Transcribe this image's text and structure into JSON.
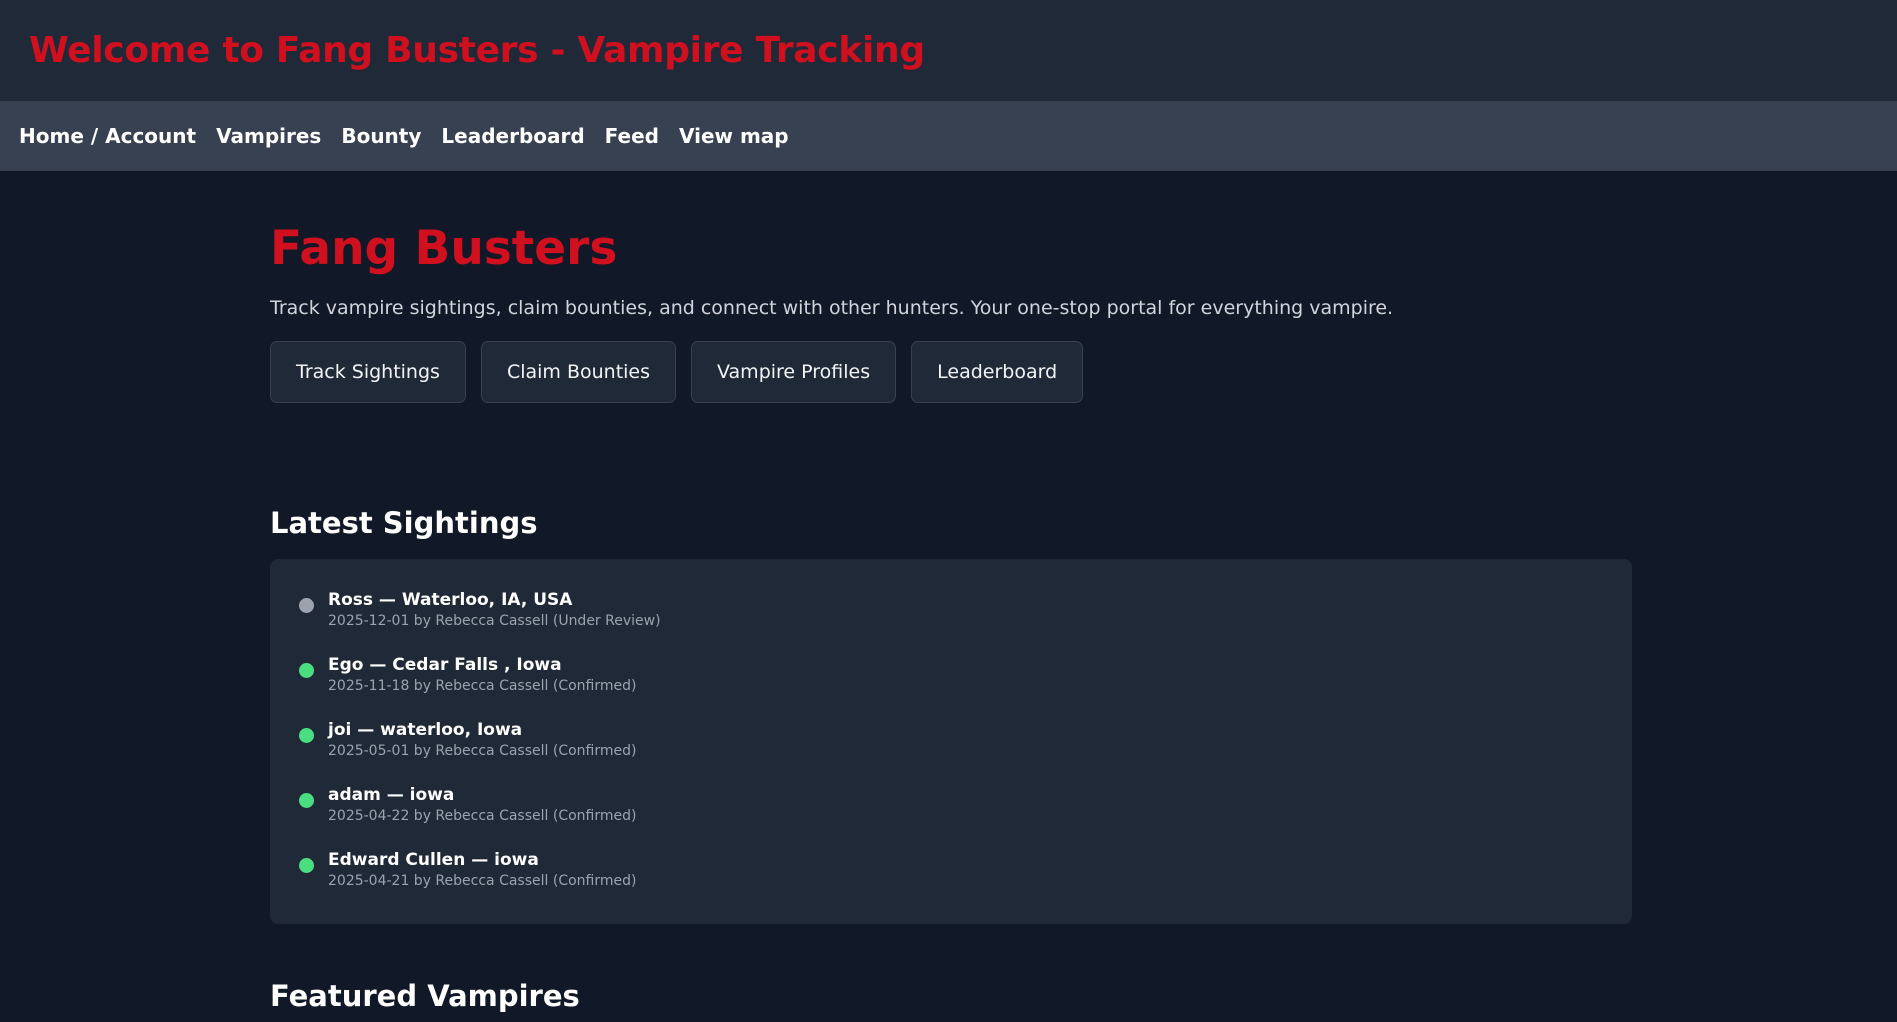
{
  "header": {
    "title": "Welcome to Fang Busters - Vampire Tracking"
  },
  "nav": {
    "items": [
      "Home / Account",
      "Vampires",
      "Bounty",
      "Leaderboard",
      "Feed",
      "View map"
    ]
  },
  "hero": {
    "title": "Fang Busters",
    "description": "Track vampire sightings, claim bounties, and connect with other hunters. Your one-stop portal for everything vampire.",
    "buttons": [
      "Track Sightings",
      "Claim Bounties",
      "Vampire Profiles",
      "Leaderboard"
    ]
  },
  "sightings": {
    "title": "Latest Sightings",
    "items": [
      {
        "title": "Ross — Waterloo, IA, USA",
        "meta": "2025-12-01 by Rebecca Cassell (Under Review)",
        "status_color": "#9ca3af"
      },
      {
        "title": "Ego — Cedar Falls , Iowa",
        "meta": "2025-11-18 by Rebecca Cassell (Confirmed)",
        "status_color": "#4ade80"
      },
      {
        "title": "joi — waterloo, Iowa",
        "meta": "2025-05-01 by Rebecca Cassell (Confirmed)",
        "status_color": "#4ade80"
      },
      {
        "title": "adam — iowa",
        "meta": "2025-04-22 by Rebecca Cassell (Confirmed)",
        "status_color": "#4ade80"
      },
      {
        "title": "Edward Cullen — iowa",
        "meta": "2025-04-21 by Rebecca Cassell (Confirmed)",
        "status_color": "#4ade80"
      }
    ]
  },
  "featured": {
    "title": "Featured Vampires"
  },
  "colors": {
    "brand_red": "#d1101f",
    "confirmed": "#4ade80",
    "under_review": "#9ca3af"
  }
}
